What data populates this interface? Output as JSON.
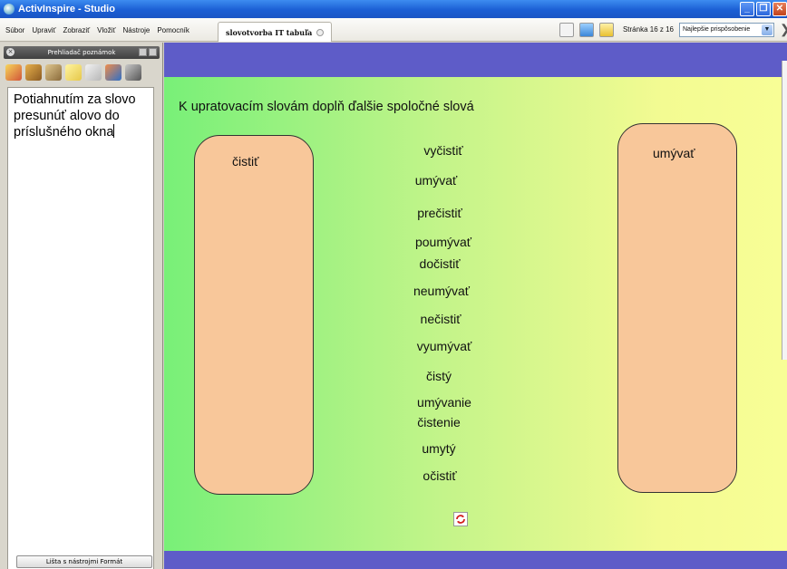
{
  "window": {
    "title": "ActivInspire - Studio"
  },
  "menu": [
    "Súbor",
    "Upraviť",
    "Zobraziť",
    "Vložiť",
    "Nástroje",
    "Pomocník"
  ],
  "document_tab": {
    "label": "slovotvorba IT tabuľa"
  },
  "toolbar": {
    "page_label": "Stránka 16 z 16",
    "fit_selected": "Najlepšie prispôsobenie",
    "icons": [
      "page-view-icon",
      "snowflake-icon",
      "folder-icon"
    ]
  },
  "left_panel": {
    "title": "Prehliadač poznámok",
    "tool_icons": [
      "pages-icon",
      "resources-icon",
      "objects-icon",
      "notes-icon",
      "properties-icon",
      "actions-icon",
      "voting-icon"
    ],
    "notes_text": "Potiahnutím za slovo presunúť alovo do príslušného okna",
    "format_button": "Lišta s nástrojmi Formát"
  },
  "canvas": {
    "instruction": "K upratovacím slovám doplň ďalšie spoločné slová",
    "box_left_label": "čistiť",
    "box_right_label": "umývať",
    "words": [
      "vyčistiť",
      "umývať",
      "prečistiť",
      "poumývať",
      "dočistiť",
      "neumývať",
      "nečistiť",
      "vyumývať",
      "čistý",
      "umývanie",
      "čistenie",
      "umytý",
      "očistiť"
    ],
    "reset_icon": "reset-icon"
  },
  "colors": {
    "canvas_band": "#5e5cc8",
    "box_fill": "#f8c79a",
    "titlebar": "#1b5fd4"
  }
}
